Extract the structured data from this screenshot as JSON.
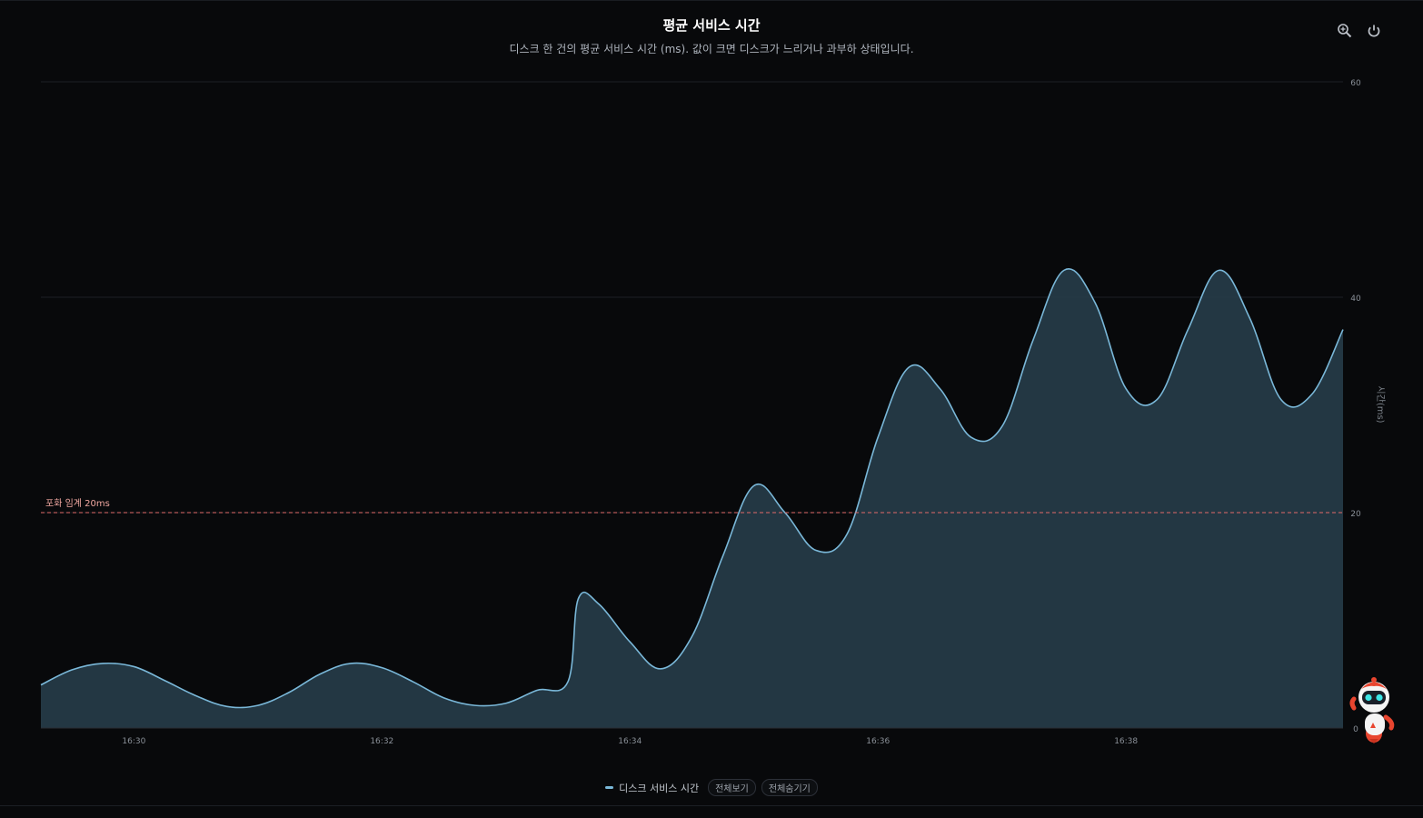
{
  "header": {
    "title": "평균 서비스 시간",
    "subtitle": "디스크 한 건의 평균 서비스 시간 (ms). 값이 크면 디스크가 느리거나 과부하 상태입니다."
  },
  "toolbar": {
    "zoom_icon": "zoom-icon",
    "reset_icon": "reset-icon"
  },
  "legend": {
    "series_label": "디스크 서비스 시간",
    "show_all_label": "전체보기",
    "hide_all_label": "전체숨기기"
  },
  "colors": {
    "background": "#08090b",
    "series_line": "#7ab8d9",
    "series_fill": "#253a47",
    "threshold": "#e06a6a",
    "grid": "#1c1f24"
  },
  "chart_data": {
    "type": "area",
    "title": "평균 서비스 시간",
    "subtitle": "디스크 한 건의 평균 서비스 시간 (ms). 값이 크면 디스크가 느리거나 과부하 상태입니다.",
    "xlabel": "",
    "ylabel": "시간(ms)",
    "ylim": [
      0,
      60
    ],
    "yticks": [
      0,
      20,
      40,
      60
    ],
    "xlim": [
      "16:29:15",
      "16:39:45"
    ],
    "xticks": [
      "16:30",
      "16:32",
      "16:34",
      "16:36",
      "16:38"
    ],
    "grid": true,
    "legend_position": "bottom-center",
    "threshold": {
      "value": 20,
      "label": "포화 임계 20ms"
    },
    "series": [
      {
        "name": "디스크 서비스 시간",
        "x": [
          "16:29:15",
          "16:29:30",
          "16:29:45",
          "16:30:00",
          "16:30:15",
          "16:30:30",
          "16:30:45",
          "16:31:00",
          "16:31:15",
          "16:31:30",
          "16:31:45",
          "16:32:00",
          "16:32:15",
          "16:32:30",
          "16:32:45",
          "16:33:00",
          "16:33:15",
          "16:33:30",
          "16:33:35",
          "16:33:45",
          "16:34:00",
          "16:34:15",
          "16:34:30",
          "16:34:45",
          "16:35:00",
          "16:35:15",
          "16:35:30",
          "16:35:45",
          "16:36:00",
          "16:36:15",
          "16:36:30",
          "16:36:45",
          "16:37:00",
          "16:37:15",
          "16:37:30",
          "16:37:45",
          "16:38:00",
          "16:38:15",
          "16:38:30",
          "16:38:45",
          "16:39:00",
          "16:39:15",
          "16:39:30",
          "16:39:45"
        ],
        "y": [
          4.0,
          5.4,
          6.0,
          5.7,
          4.4,
          3.0,
          2.0,
          2.1,
          3.3,
          5.0,
          6.0,
          5.6,
          4.3,
          2.8,
          2.1,
          2.3,
          3.5,
          4.3,
          12.0,
          11.5,
          8.0,
          5.5,
          8.5,
          16.0,
          22.5,
          20.0,
          16.5,
          18.0,
          27.0,
          33.5,
          31.5,
          27.0,
          28.0,
          36.0,
          42.5,
          39.5,
          31.5,
          30.5,
          37.0,
          42.5,
          38.0,
          30.5,
          31.0,
          37.0
        ]
      }
    ]
  }
}
